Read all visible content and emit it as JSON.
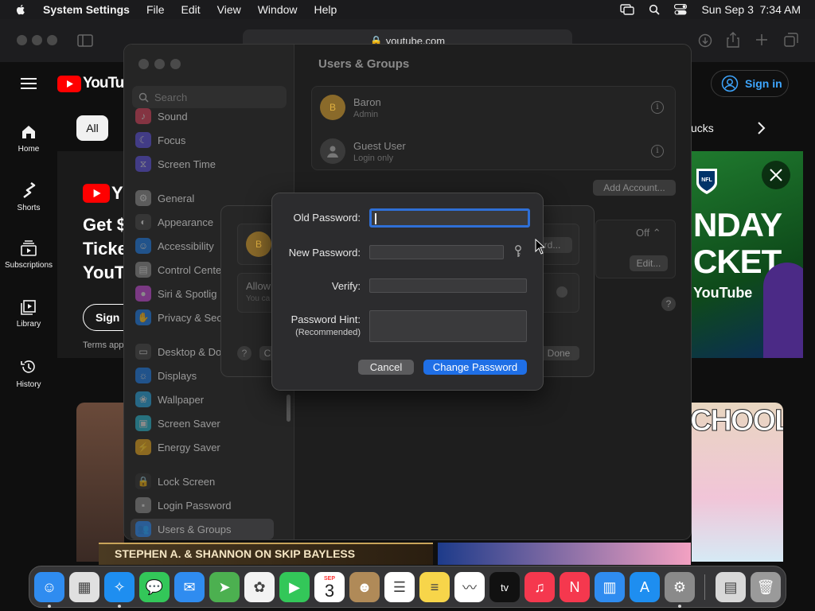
{
  "menubar": {
    "app_name": "System Settings",
    "menus": [
      "File",
      "Edit",
      "View",
      "Window",
      "Help"
    ],
    "datetime": "Sun Sep 3  7:34 AM"
  },
  "browser": {
    "url": "youtube.com"
  },
  "youtube": {
    "logo": "YouTube",
    "sign_in": "Sign in",
    "chip_all": "All",
    "chip_right": "ucks",
    "nav": [
      {
        "label": "Home",
        "icon": "home-icon"
      },
      {
        "label": "Shorts",
        "icon": "shorts-icon"
      },
      {
        "label": "Subscriptions",
        "icon": "subscriptions-icon"
      },
      {
        "label": "Library",
        "icon": "library-icon"
      },
      {
        "label": "History",
        "icon": "history-icon"
      }
    ],
    "promo_line1": "Get $",
    "promo_line2": "Ticke",
    "promo_line3": "YouT",
    "promo_button": "Sign u",
    "promo_terms": "Terms app",
    "banner_text1": "NDAY",
    "banner_text2": "CKET",
    "banner_brand": "YouTube",
    "thumb_right_text": "CHOOL",
    "thumb_bottom_text": "STEPHEN A. & SHANNON ON SKIP BAYLESS"
  },
  "settings": {
    "search_placeholder": "Search",
    "sidebar": [
      {
        "label": "Sound",
        "icon": "sound-icon",
        "color": "#d2415b"
      },
      {
        "label": "Focus",
        "icon": "focus-icon",
        "color": "#5b4fd6"
      },
      {
        "label": "Screen Time",
        "icon": "screen-time-icon",
        "color": "#5b4fd6"
      },
      {
        "label": "General",
        "icon": "gear-icon",
        "color": "#8a8a8a"
      },
      {
        "label": "Appearance",
        "icon": "appearance-icon",
        "color": "#444444"
      },
      {
        "label": "Accessibility",
        "icon": "accessibility-icon",
        "color": "#1f7ae0"
      },
      {
        "label": "Control Cente",
        "icon": "control-center-icon",
        "color": "#8a8a8a"
      },
      {
        "label": "Siri & Spotlig",
        "icon": "siri-icon",
        "color": "#c04ad0"
      },
      {
        "label": "Privacy & Sec",
        "icon": "hand-icon",
        "color": "#1f7ae0"
      },
      {
        "label": "Desktop & Do",
        "icon": "desktop-icon",
        "color": "#444444"
      },
      {
        "label": "Displays",
        "icon": "displays-icon",
        "color": "#1f7ae0"
      },
      {
        "label": "Wallpaper",
        "icon": "wallpaper-icon",
        "color": "#2a9fd6"
      },
      {
        "label": "Screen Saver",
        "icon": "screen-saver-icon",
        "color": "#2ab0c8"
      },
      {
        "label": "Energy Saver",
        "icon": "energy-icon",
        "color": "#e0a21f"
      },
      {
        "label": "Lock Screen",
        "icon": "lock-icon",
        "color": "#333333"
      },
      {
        "label": "Login Password",
        "icon": "login-password-icon",
        "color": "#8a8a8a"
      },
      {
        "label": "Users & Groups",
        "icon": "users-icon",
        "color": "#1f7ae0"
      }
    ],
    "pane_title": "Users & Groups",
    "users": [
      {
        "name": "Baron",
        "role": "Admin",
        "initial": "B"
      },
      {
        "name": "Guest User",
        "role": "Login only"
      }
    ],
    "add_account": "Add Account...",
    "off_label": "Off",
    "edit_label": "Edit...",
    "sheet_allow": "Allow",
    "sheet_allow_sub": "You ca",
    "sheet_btn_right": "rd...",
    "sheet_done": "Done",
    "sheet_btn_left": "C"
  },
  "dialog": {
    "old_password_label": "Old Password:",
    "new_password_label": "New Password:",
    "verify_label": "Verify:",
    "hint_label": "Password Hint:",
    "hint_sub": "(Recommended)",
    "cancel": "Cancel",
    "change_password": "Change Password"
  },
  "dock": {
    "calendar_month": "SEP",
    "calendar_day": "3",
    "apps": [
      {
        "name": "finder-icon",
        "color": "#2f8cf0"
      },
      {
        "name": "launchpad-icon",
        "color": "#e0e0e0"
      },
      {
        "name": "safari-icon",
        "color": "#1e8ef0"
      },
      {
        "name": "messages-icon",
        "color": "#33c759"
      },
      {
        "name": "mail-icon",
        "color": "#2f8cf0"
      },
      {
        "name": "maps-icon",
        "color": "#4cb050"
      },
      {
        "name": "photos-icon",
        "color": "#f3f3f3"
      },
      {
        "name": "facetime-icon",
        "color": "#33c759"
      },
      {
        "name": "calendar-icon",
        "color": "#ffffff"
      },
      {
        "name": "contacts-icon",
        "color": "#b08a58"
      },
      {
        "name": "reminders-icon",
        "color": "#ffffff"
      },
      {
        "name": "notes-icon",
        "color": "#f7d54a"
      },
      {
        "name": "freeform-icon",
        "color": "#ffffff"
      },
      {
        "name": "tv-icon",
        "color": "#111111"
      },
      {
        "name": "music-icon",
        "color": "#f5384e"
      },
      {
        "name": "news-icon",
        "color": "#f5384e"
      },
      {
        "name": "keynote-icon",
        "color": "#2f8cf0"
      },
      {
        "name": "app-store-icon",
        "color": "#1e8ef0"
      },
      {
        "name": "system-settings-icon",
        "color": "#8a8a8a"
      },
      {
        "name": "preview-icon",
        "color": "#d8d8d8"
      },
      {
        "name": "trash-icon",
        "color": "#9a9a9a"
      }
    ]
  }
}
